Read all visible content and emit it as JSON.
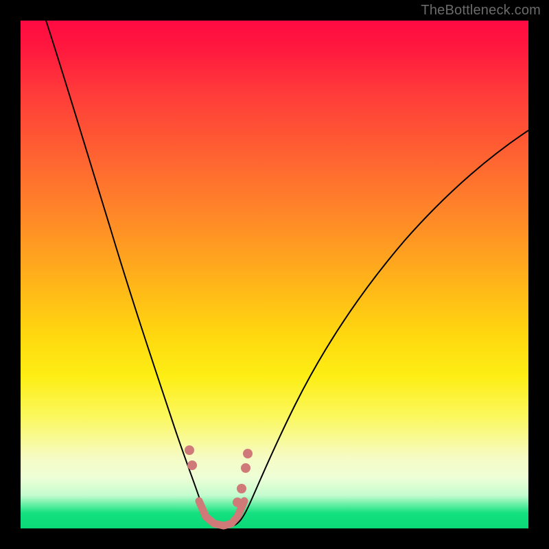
{
  "watermark": "TheBottleneck.com",
  "colors": {
    "top_gradient": "#ff0a42",
    "bottom_gradient": "#0bd877",
    "curve": "#000000",
    "marker": "#cf7a78",
    "frame": "#000000"
  },
  "chart_data": {
    "type": "line",
    "title": "",
    "xlabel": "",
    "ylabel": "",
    "xlim": [
      0,
      100
    ],
    "ylim": [
      0,
      100
    ],
    "note": "Bottleneck-style V-curve. x is a relative parameter (≈ component balance), y is bottleneck % (0 = balanced/green, 100 = severe/red). Values estimated from pixel positions; no axis ticks shown in image.",
    "series": [
      {
        "name": "left-arm",
        "x": [
          5,
          7,
          9,
          11,
          13,
          15,
          17,
          19,
          21,
          23,
          25,
          27,
          28.5,
          30,
          31.5,
          33,
          34,
          35,
          36.5
        ],
        "y": [
          100,
          92,
          84,
          76,
          68,
          61,
          54,
          47,
          40,
          33.5,
          27,
          21,
          16.5,
          12.5,
          9,
          6,
          4,
          2.5,
          1.2
        ]
      },
      {
        "name": "right-arm",
        "x": [
          42,
          43,
          44,
          45.5,
          47,
          49,
          51,
          54,
          57,
          60,
          64,
          68,
          72,
          76,
          80,
          85,
          90,
          95,
          100
        ],
        "y": [
          1.2,
          2.5,
          4,
          6,
          8.5,
          12,
          16,
          21,
          26,
          31,
          37,
          42.5,
          47.5,
          52,
          56,
          60.5,
          64.5,
          68,
          71
        ]
      },
      {
        "name": "valley-floor",
        "x": [
          36.5,
          38,
          39.5,
          41,
          42
        ],
        "y": [
          1.2,
          0.5,
          0.4,
          0.5,
          1.2
        ]
      }
    ],
    "markers": {
      "name": "highlighted-range",
      "points_xy": [
        [
          33.2,
          15.5
        ],
        [
          33.8,
          12.3
        ],
        [
          35.3,
          5.2
        ],
        [
          36.5,
          2.0
        ],
        [
          38.2,
          0.8
        ],
        [
          40.0,
          0.8
        ],
        [
          41.5,
          2.0
        ],
        [
          42.6,
          5.0
        ],
        [
          43.2,
          8.0
        ],
        [
          44.0,
          12.0
        ],
        [
          44.6,
          15.0
        ]
      ]
    }
  }
}
